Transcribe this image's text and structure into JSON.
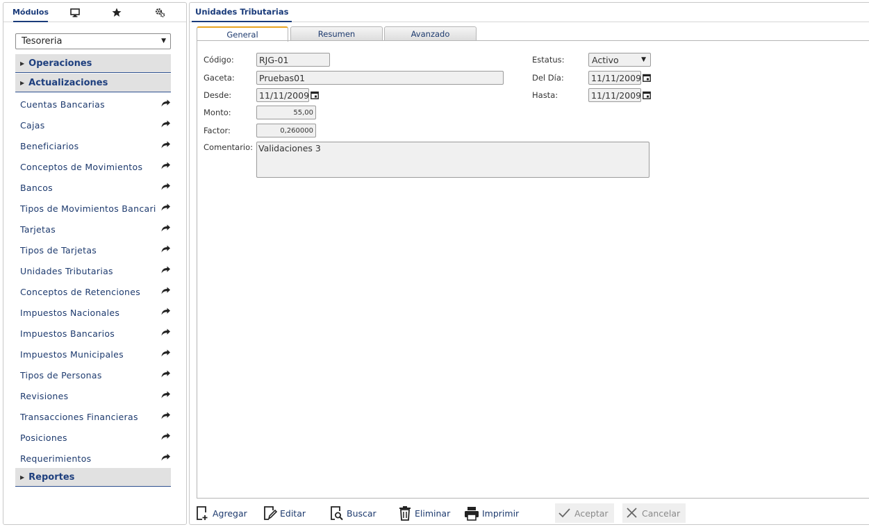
{
  "left_tabs": {
    "modulos": "Módulos"
  },
  "module_select": {
    "value": "Tesoreria"
  },
  "sections": {
    "operaciones": "Operaciones",
    "actualizaciones": "Actualizaciones",
    "reportes": "Reportes"
  },
  "menu_items": [
    "Cuentas Bancarias",
    "Cajas",
    "Beneficiarios",
    "Conceptos de Movimientos",
    "Bancos",
    "Tipos de Movimientos Bancari",
    "Tarjetas",
    "Tipos de Tarjetas",
    "Unidades Tributarias",
    "Conceptos de Retenciones",
    "Impuestos Nacionales",
    "Impuestos Bancarios",
    "Impuestos Municipales",
    "Tipos de Personas",
    "Revisiones",
    "Transacciones Financieras",
    "Posiciones",
    "Requerimientos"
  ],
  "right": {
    "title": "Unidades Tributarias",
    "tabs": [
      "General",
      "Resumen",
      "Avanzado"
    ]
  },
  "form": {
    "codigo_label": "Código:",
    "codigo_value": "RJG-01",
    "gaceta_label": "Gaceta:",
    "gaceta_value": "Pruebas01",
    "desde_label": "Desde:",
    "desde_value": "11/11/2009",
    "monto_label": "Monto:",
    "monto_value": "55,00",
    "factor_label": "Factor:",
    "factor_value": "0,260000",
    "comentario_label": "Comentario:",
    "comentario_value": "Validaciones 3",
    "estatus_label": "Estatus:",
    "estatus_value": "Activo",
    "deldia_label": "Del Día:",
    "deldia_value": "11/11/2009",
    "hasta_label": "Hasta:",
    "hasta_value": "11/11/2009"
  },
  "toolbar": {
    "agregar": "Agregar",
    "editar": "Editar",
    "buscar": "Buscar",
    "eliminar": "Eliminar",
    "imprimir": "Imprimir",
    "aceptar": "Aceptar",
    "cancelar": "Cancelar"
  },
  "colors": {
    "accent": "#1a3b7a",
    "tab_highlight": "#e8a31e",
    "section_bg": "#e1e1e1"
  }
}
